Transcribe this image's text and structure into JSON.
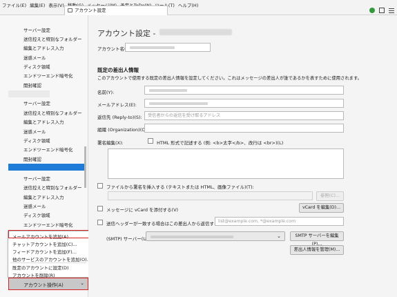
{
  "menubar": {
    "items": [
      "ファイル(E)",
      "編集(E)",
      "表示(V)",
      "移動(G)",
      "メッセージ(M)",
      "予定とToDo(N)",
      "ツール(T)",
      "ヘルプ(H)"
    ],
    "tab_title": "アカウント設定"
  },
  "sidebar": {
    "group1": [
      "サーバー設定",
      "送信控えと特別なフォルダー",
      "編集とアドレス入力",
      "迷惑メール",
      "ディスク領域",
      "エンドツーエンド暗号化",
      "開封確認"
    ],
    "group2": [
      "サーバー設定",
      "送信控えと特別なフォルダー",
      "編集とアドレス入力",
      "迷惑メール",
      "ディスク領域",
      "エンドツーエンド暗号化",
      "開封確認"
    ],
    "group3": [
      "サーバー設定",
      "送信控えと特別なフォルダー",
      "編集とアドレス入力",
      "迷惑メール",
      "ディスク領域",
      "エンドツーエンド暗号化"
    ],
    "menu": {
      "add_mail": "メールアカウントを追加(A)...",
      "add_chat": "チャットアカウントを追加(C)...",
      "add_feed": "フィードアカウントを追加(F)...",
      "add_other": "他のサービスのアカウントを追加(O)...",
      "set_default": "既定のアカウントに設定(D)",
      "remove": "アカウントを削除(R)"
    },
    "actions_button": "アカウント操作(A)"
  },
  "main": {
    "title": "アカウント設定 -",
    "account_name_label": "アカウント名(N):",
    "section_title": "既定の差出人情報",
    "section_desc": "このアカウントで使用する既定の差出人情報を設定してください。これはメッセージの差出人が誰であるかを表すために使用されます。",
    "name_label": "名前(Y):",
    "email_label": "メールアドレス(E):",
    "reply_to_label": "返信先 (Reply-to)(S):",
    "reply_to_placeholder": "受信者からの返信を受け取るアドレス",
    "org_label": "組織 (Organization)(O):",
    "sig_label": "署名編集(X):",
    "html_check_label": "HTML 形式で記述する (例: <b>太字</b>、改行は <br>)(L)",
    "sig_file_label": "ファイルから署名を挿入する (テキストまたは HTML、画像ファイル)(T):",
    "browse_button": "参照(C)...",
    "vcard_label": "メッセージに vCard を添付する(V)",
    "vcard_button": "vCard を編集(D)...",
    "reply_header_label": "送信ヘッダーが一致する場合はこの差出人から返信する(D):",
    "reply_header_placeholder": "list@example.com, *@example.com",
    "smtp_label": "(SMTP) サーバー(U):",
    "smtp_edit_button": "SMTP サーバーを編集(P)...",
    "manage_button": "差出人情報を管理(M)..."
  }
}
